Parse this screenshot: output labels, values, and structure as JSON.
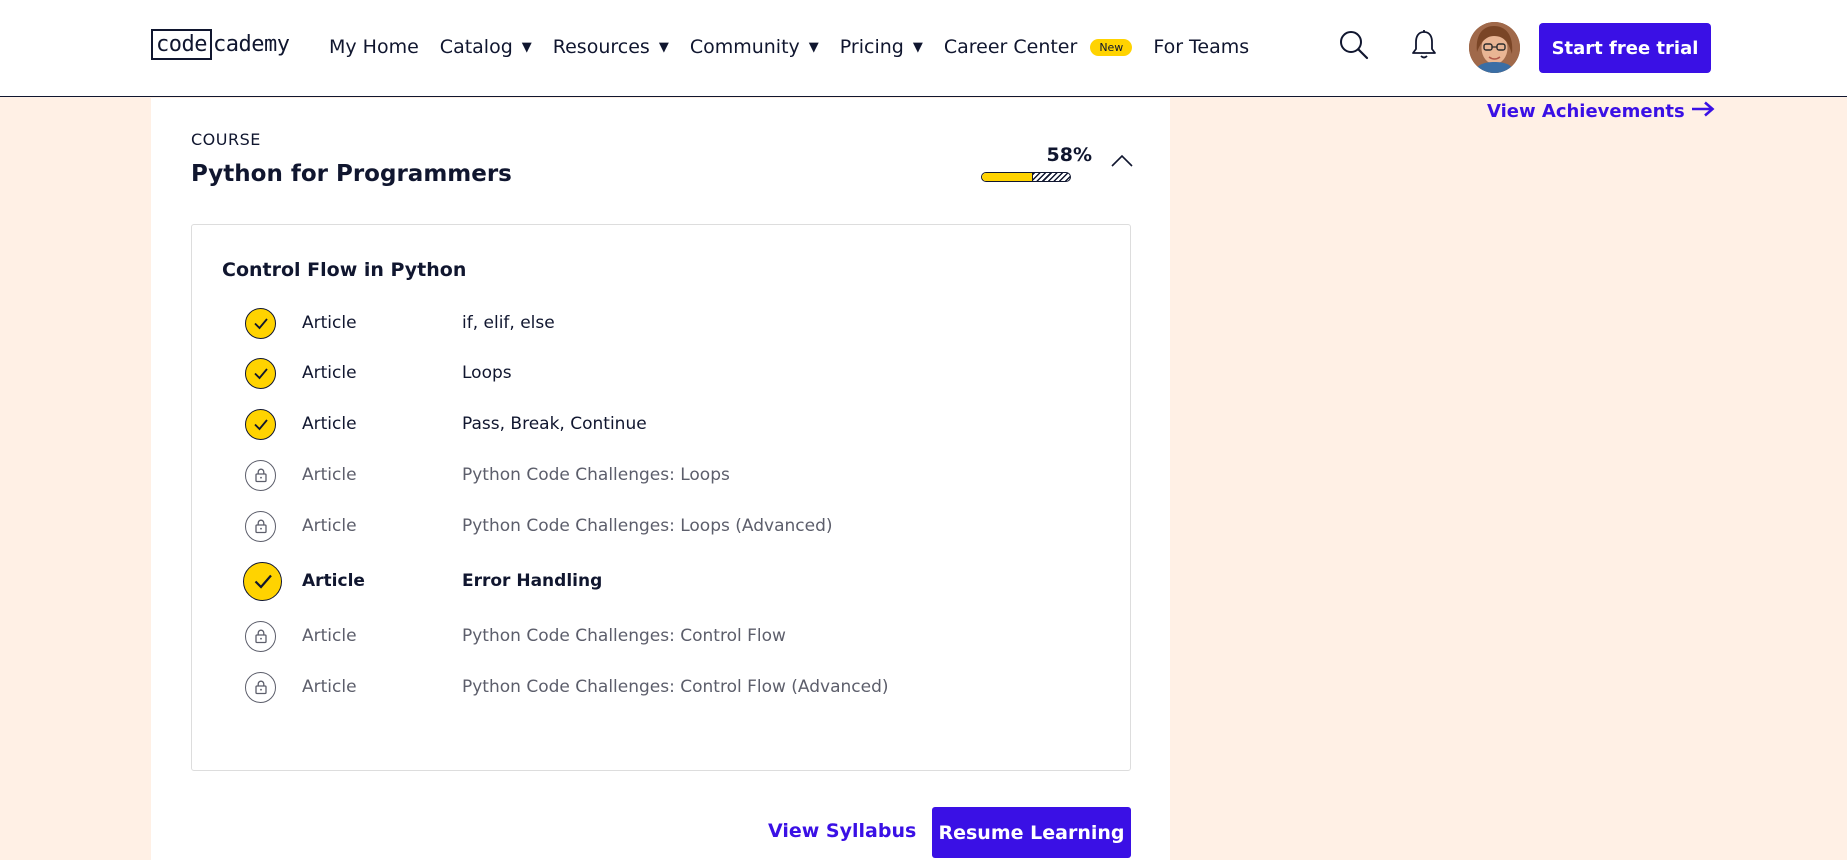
{
  "navbar": {
    "logo_code": "code",
    "logo_cademy": "cademy",
    "items": [
      {
        "label": "My Home"
      },
      {
        "label": "Catalog"
      },
      {
        "label": "Resources"
      },
      {
        "label": "Community"
      },
      {
        "label": "Pricing"
      },
      {
        "label": "Career Center",
        "badge": "New"
      },
      {
        "label": "For Teams"
      }
    ],
    "trial_label": "Start free trial",
    "icons": [
      "search-icon",
      "bell-icon"
    ]
  },
  "sidebar": {
    "achievements_label": "View Achievements",
    "arrow": "→"
  },
  "course": {
    "label": "COURSE",
    "title": "Python for Programmers",
    "progress_text": "58%",
    "progress_value": 0.58,
    "module": {
      "title": "Control Flow in Python",
      "lessons": [
        {
          "type": "Article",
          "name": "if, elif, else",
          "status": "done"
        },
        {
          "type": "Article",
          "name": "Loops",
          "status": "done"
        },
        {
          "type": "Article",
          "name": "Pass, Break, Continue",
          "status": "done"
        },
        {
          "type": "Article",
          "name": "Python Code Challenges: Loops",
          "status": "locked"
        },
        {
          "type": "Article",
          "name": "Python Code Challenges: Loops (Advanced)",
          "status": "locked"
        },
        {
          "type": "Article",
          "name": "Error Handling",
          "status": "current"
        },
        {
          "type": "Article",
          "name": "Python Code Challenges: Control Flow",
          "status": "locked"
        },
        {
          "type": "Article",
          "name": "Python Code Challenges: Control Flow (Advanced)",
          "status": "locked"
        }
      ]
    },
    "syllabus_label": "View Syllabus",
    "resume_label": "Resume Learning"
  },
  "colors": {
    "accent": "#3a10e5",
    "yellow": "#ffd300",
    "navy": "#10162f",
    "page_bg": "#fff0e5"
  }
}
